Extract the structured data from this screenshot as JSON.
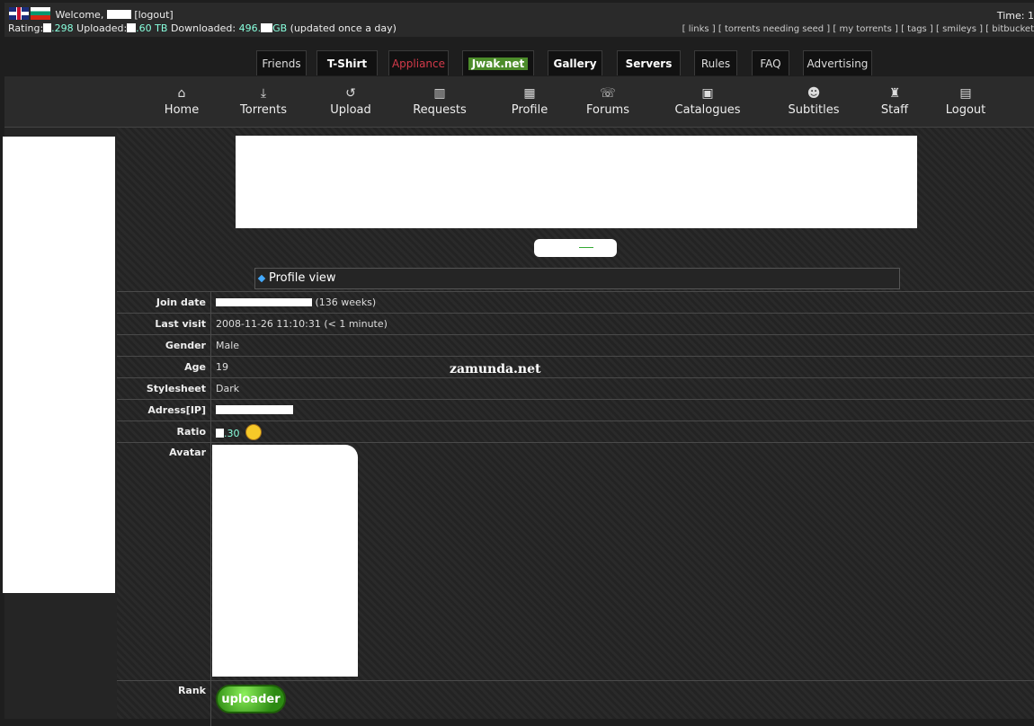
{
  "topbar": {
    "welcome": "Welcome,",
    "logout_link": "[logout]",
    "rating_label": "Rating:",
    "rating_value": ".298",
    "uploaded_label": "Uploaded:",
    "uploaded_value": ".60 TB",
    "downloaded_label": "Downloaded:",
    "downloaded_value": "496.",
    "downloaded_unit": "GB",
    "updated_note": "(updated once a day)",
    "time": "Time: 1",
    "links": [
      "[ links ]",
      "[ torrents needing seed ]",
      "[ my torrents ]",
      "[ tags ]",
      "[ smileys ]",
      "[ bitbucket"
    ]
  },
  "tabs": [
    "Friends",
    "T-Shirt",
    "Appliance",
    "Jwak.net",
    "Gallery",
    "Servers",
    "Rules",
    "FAQ",
    "Advertising"
  ],
  "menu": [
    {
      "label": "Home",
      "icon": "home-icon"
    },
    {
      "label": "Torrents",
      "icon": "download-icon"
    },
    {
      "label": "Upload",
      "icon": "upload-icon"
    },
    {
      "label": "Requests",
      "icon": "requests-icon"
    },
    {
      "label": "Profile",
      "icon": "profile-icon"
    },
    {
      "label": "Forums",
      "icon": "forums-icon"
    },
    {
      "label": "Catalogues",
      "icon": "film-icon"
    },
    {
      "label": "Subtitles",
      "icon": "subtitles-icon"
    },
    {
      "label": "Staff",
      "icon": "staff-icon"
    },
    {
      "label": "Logout",
      "icon": "logout-icon"
    }
  ],
  "profile_view": {
    "title": "Profile view",
    "rows": {
      "join_date": {
        "label": "Join date",
        "value": "(136 weeks)"
      },
      "last_visit": {
        "label": "Last visit",
        "value": "2008-11-26 11:10:31 (< 1 minute)"
      },
      "gender": {
        "label": "Gender",
        "value": "Male"
      },
      "age": {
        "label": "Age",
        "value": "19"
      },
      "stylesheet": {
        "label": "Stylesheet",
        "value": "Dark"
      },
      "ip": {
        "label": "Adress[IP]",
        "value": ""
      },
      "ratio": {
        "label": "Ratio",
        "value": ".30"
      },
      "avatar": {
        "label": "Avatar"
      },
      "rank": {
        "label": "Rank",
        "badge": "uploader"
      }
    }
  },
  "watermark": "zamunda.net",
  "colors": {
    "appliance_tab": "#d33a4a",
    "jwak_badge": "#4c8c2a",
    "accent_teal": "#88ffdd"
  }
}
